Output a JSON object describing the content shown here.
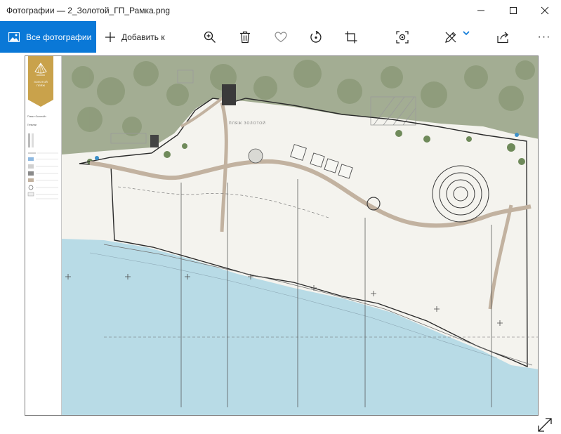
{
  "window": {
    "title": "Фотографии — 2_Золотой_ГП_Рамка.png",
    "controls": [
      "minimize",
      "maximize",
      "close"
    ]
  },
  "toolbar": {
    "all_photos_label": "Все фотографии",
    "add_label": "Добавить к",
    "icons": [
      "zoom-in-icon",
      "delete-icon",
      "favorite-icon",
      "rotate-icon",
      "crop-icon",
      "enhance-icon",
      "edit-draw-icon",
      "share-icon",
      "more-icon"
    ],
    "more_label": "···"
  },
  "image": {
    "badge_text": "Золотой пляж",
    "legend_title": "Пляж «Золотой»",
    "legend_subtitle": "Генплан",
    "plan_labels": [
      "ПЛЯЖ ЗОЛОТОЙ"
    ],
    "colors": {
      "water": "#b8dbe6",
      "path": "#c2b2a0",
      "vegetation": "#8d9b7a",
      "beach": "#f2f1ea",
      "badge": "#c9a24b",
      "accent": "#0a78d7"
    }
  }
}
